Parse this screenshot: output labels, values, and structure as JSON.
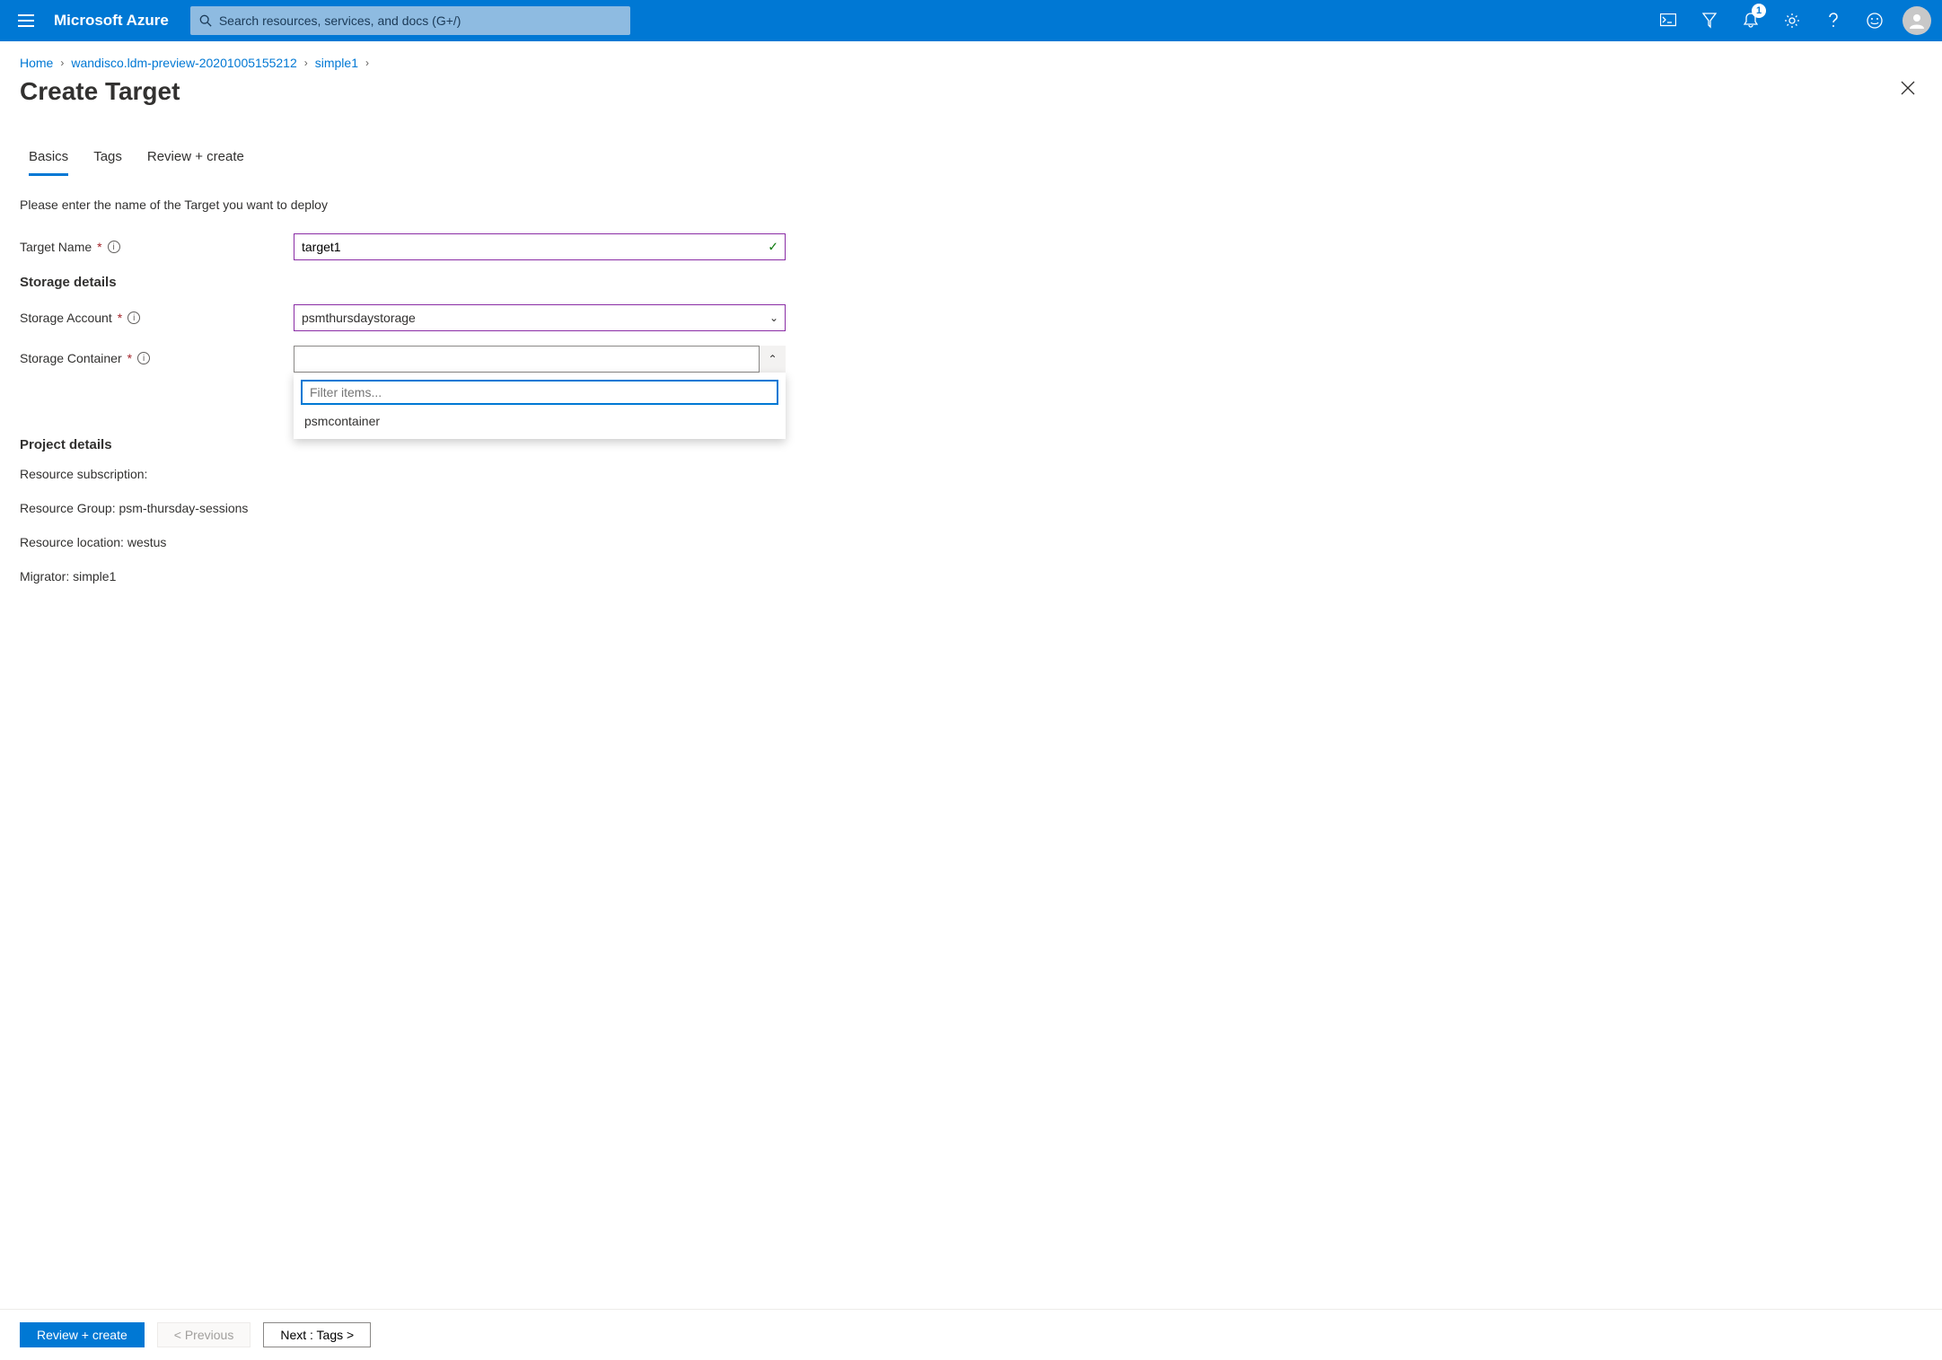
{
  "brand": "Microsoft Azure",
  "search_placeholder": "Search resources, services, and docs (G+/)",
  "notification_count": "1",
  "breadcrumb": {
    "items": [
      "Home",
      "wandisco.ldm-preview-20201005155212",
      "simple1"
    ]
  },
  "page_title": "Create Target",
  "tabs": [
    "Basics",
    "Tags",
    "Review + create"
  ],
  "intro_text": "Please enter the name of the Target you want to deploy",
  "form": {
    "target_name_label": "Target Name",
    "target_name_value": "target1",
    "storage_section": "Storage details",
    "storage_account_label": "Storage Account",
    "storage_account_value": "psmthursdaystorage",
    "storage_container_label": "Storage Container",
    "storage_container_value": "",
    "filter_placeholder": "Filter items...",
    "dropdown_options": [
      "psmcontainer"
    ],
    "project_section": "Project details",
    "resource_subscription_label": "Resource subscription:",
    "resource_group_line": "Resource Group: psm-thursday-sessions",
    "resource_location_line": "Resource location: westus",
    "migrator_line": "Migrator: simple1"
  },
  "footer": {
    "review": "Review + create",
    "previous": "< Previous",
    "next": "Next : Tags >"
  }
}
